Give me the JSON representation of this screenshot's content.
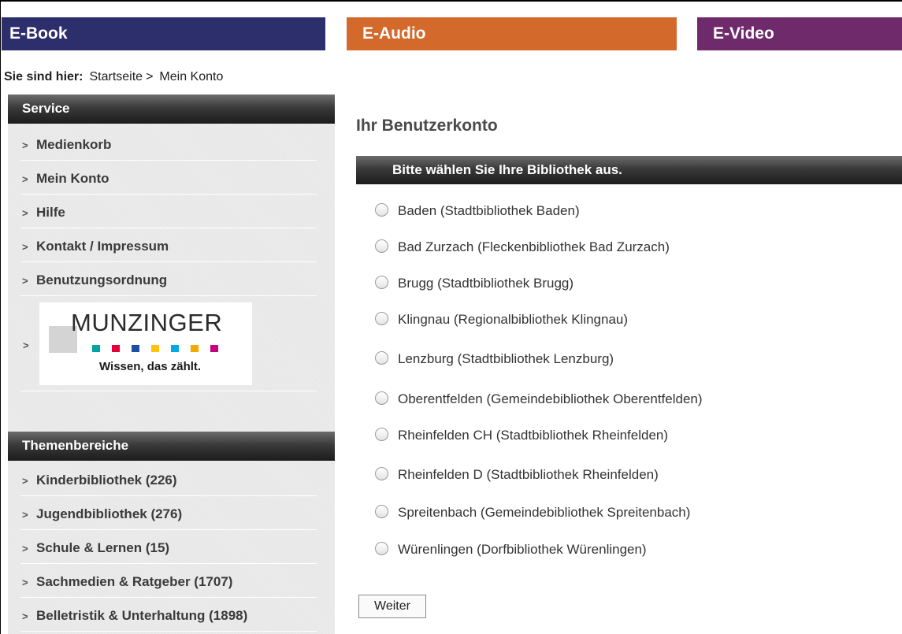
{
  "tabs": {
    "ebook": "E-Book",
    "eaudio": "E-Audio",
    "evideo": "E-Video"
  },
  "breadcrumb": {
    "label": "Sie sind hier:",
    "items": [
      "Startseite",
      "Mein Konto"
    ],
    "separator": ">"
  },
  "service": {
    "title": "Service",
    "items": [
      {
        "label": "Medienkorb"
      },
      {
        "label": "Mein Konto"
      },
      {
        "label": "Hilfe"
      },
      {
        "label": "Kontakt / Impressum"
      },
      {
        "label": "Benutzungsordnung"
      }
    ],
    "munzinger": {
      "name": "MUNZINGER",
      "tagline": "Wissen, das zählt.",
      "dot_colors": [
        "#00a1a7",
        "#e4003a",
        "#1e4fa0",
        "#ffc20e",
        "#00a9e0",
        "#f4a900",
        "#c8007c"
      ]
    }
  },
  "themen": {
    "title": "Themenbereiche",
    "items": [
      {
        "label": "Kinderbibliothek (226)"
      },
      {
        "label": "Jugendbibliothek (276)"
      },
      {
        "label": "Schule & Lernen (15)"
      },
      {
        "label": "Sachmedien & Ratgeber (1707)"
      },
      {
        "label": "Belletristik & Unterhaltung (1898)"
      }
    ]
  },
  "main": {
    "title": "Ihr Benutzerkonto",
    "select_header": "Bitte wählen Sie Ihre Bibliothek aus.",
    "libraries": [
      "Baden (Stadtbibliothek Baden)",
      "Bad Zurzach (Fleckenbibliothek Bad Zurzach)",
      "Brugg (Stadtbibliothek Brugg)",
      "Klingnau (Regionalbibliothek Klingnau)",
      "Lenzburg (Stadtbibliothek Lenzburg)",
      "Oberentfelden (Gemeindebibliothek Oberentfelden)",
      "Rheinfelden CH (Stadtbibliothek Rheinfelden)",
      "Rheinfelden D (Stadtbibliothek Rheinfelden)",
      "Spreitenbach (Gemeindebibliothek Spreitenbach)",
      "Würenlingen (Dorfbibliothek Würenlingen)"
    ],
    "submit_label": "Weiter"
  },
  "colors": {
    "ebook": "#2d2e6c",
    "eaudio": "#d3692a",
    "evideo": "#6e2a6b"
  }
}
